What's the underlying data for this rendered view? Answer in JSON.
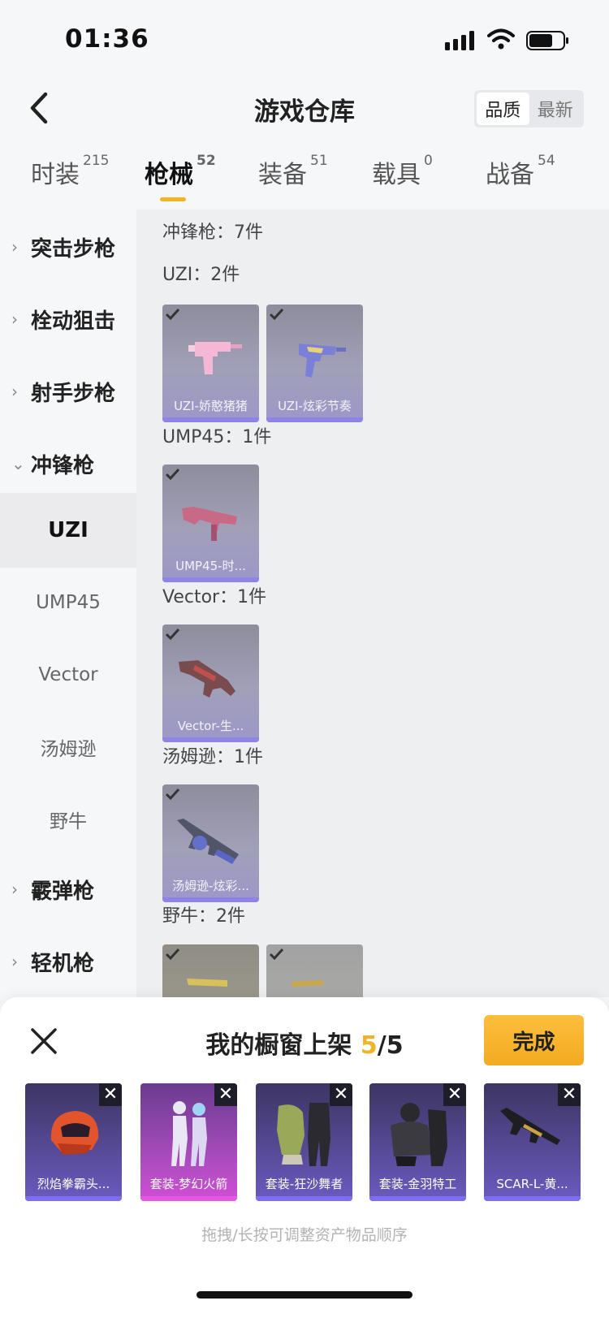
{
  "status": {
    "time": "01:36"
  },
  "header": {
    "title": "游戏仓库",
    "sort_options": [
      "品质",
      "最新"
    ]
  },
  "tabs": [
    {
      "label": "时装",
      "count": "215"
    },
    {
      "label": "枪械",
      "count": "52"
    },
    {
      "label": "装备",
      "count": "51"
    },
    {
      "label": "载具",
      "count": "0"
    },
    {
      "label": "战备",
      "count": "54"
    }
  ],
  "sidebar": [
    {
      "label": "突击步枪",
      "type": "group",
      "chevron": "›"
    },
    {
      "label": "栓动狙击",
      "type": "group",
      "chevron": "›"
    },
    {
      "label": "射手步枪",
      "type": "group",
      "chevron": "›"
    },
    {
      "label": "冲锋枪",
      "type": "group",
      "chevron": "⌄"
    },
    {
      "label": "UZI",
      "type": "sub"
    },
    {
      "label": "UMP45",
      "type": "sub"
    },
    {
      "label": "Vector",
      "type": "sub"
    },
    {
      "label": "汤姆逊",
      "type": "sub"
    },
    {
      "label": "野牛",
      "type": "sub"
    },
    {
      "label": "霰弹枪",
      "type": "group",
      "chevron": "›"
    },
    {
      "label": "轻机枪",
      "type": "group",
      "chevron": "›"
    }
  ],
  "content": {
    "category_total": "冲锋枪：7件",
    "groups": [
      {
        "label": "UZI：2件",
        "items": [
          "UZI-娇憨猪猪",
          "UZI-炫彩节奏"
        ]
      },
      {
        "label": "UMP45：1件",
        "items": [
          "UMP45-时..."
        ]
      },
      {
        "label": "Vector：1件",
        "items": [
          "Vector-生..."
        ]
      },
      {
        "label": "汤姆逊：1件",
        "items": [
          "汤姆逊-炫彩..."
        ]
      },
      {
        "label": "野牛：2件",
        "items": [
          "",
          ""
        ]
      }
    ]
  },
  "sheet": {
    "title_prefix": "我的橱窗上架 ",
    "count_current": "5",
    "count_sep_total": "/5",
    "done_label": "完成",
    "slots": [
      {
        "name": "烈焰拳霸头...",
        "icon": "helmet-icon"
      },
      {
        "name": "套装-梦幻火箭",
        "icon": "outfit-icon"
      },
      {
        "name": "套装-狂沙舞者",
        "icon": "outfit-icon"
      },
      {
        "name": "套装-金羽特工",
        "icon": "outfit-icon"
      },
      {
        "name": "SCAR-L-黄...",
        "icon": "rifle-icon"
      }
    ],
    "remove_glyph": "✕",
    "hint": "拖拽/长按可调整资产物品顺序"
  },
  "colors": {
    "accent": "#f3b524",
    "rarity_purple": "#8e84e8",
    "rarity_pink": "#e259e6"
  }
}
